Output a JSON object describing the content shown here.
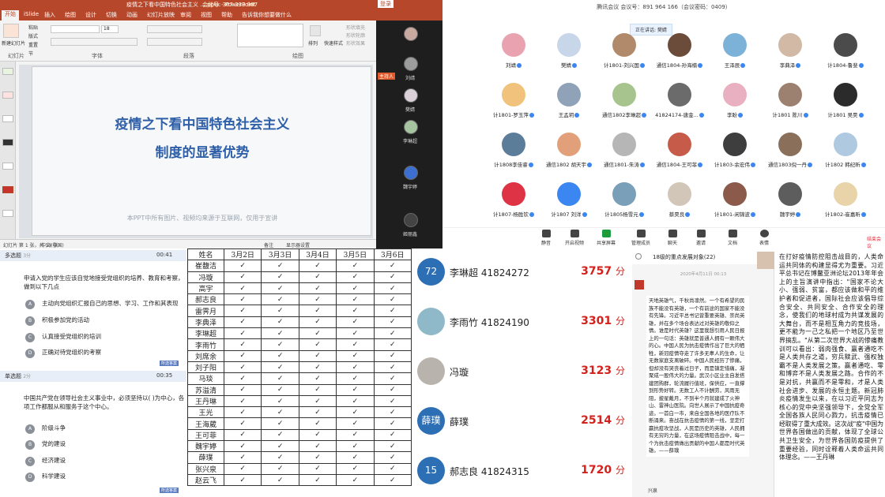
{
  "ppt": {
    "title": "疫情之下看中国特色社会主义 ... pptx - PowerPoint",
    "meeting_id": "会议号: 307 333 987",
    "login": "登录",
    "tabs": [
      "开始",
      "iSlide",
      "插入",
      "绘图",
      "设计",
      "切换",
      "动画",
      "幻灯片放映",
      "审阅",
      "视图",
      "帮助",
      "告诉我你想要做什么"
    ],
    "groups": [
      "幻灯片",
      "字体",
      "段落",
      "绘图"
    ],
    "buttons": {
      "new_slide": "新建幻灯片",
      "paste": "粘贴",
      "layout": "版式",
      "reset": "重置",
      "section": "节",
      "arrange": "排列",
      "quick_style": "快速样式",
      "shape_fill": "形状填充",
      "shape_outline": "形状轮廓",
      "shape_effect": "形状效果"
    },
    "font_size": "18",
    "slide_title_1": "疫情之下看中国特色社会主义",
    "slide_title_2": "制度的显著优势",
    "slide_note": "本PPT中所有图片、视频均来源于互联网，仅用于宣讲",
    "status_slide": "幻灯片 第 1 张，共 19 张",
    "status_lang": "中文(中国)",
    "status_notes": "备注",
    "status_display": "显示器设置",
    "video_names": [
      "",
      "刘靖",
      "樊婧",
      "李琳超",
      "魏宇婷",
      "姬丽鑫"
    ],
    "host_badge": "主持人"
  },
  "meeting": {
    "title": "腾讯会议  会议号：891 964 166（会议密码：0409）",
    "speaking": "正在讲话: 樊婧",
    "participants": [
      [
        "刘靖",
        "樊婧",
        "计1801-刘兴国",
        "通信1804-孙海楠",
        "王泽辰",
        "李典泽",
        "计1804-鲁斐"
      ],
      [
        "计1801-罗玉萍",
        "王孟玥",
        "通信1802李琳超",
        "41824174-唐金...",
        "李盼",
        "计1801 陈川",
        "计1801 吴昊"
      ],
      [
        "计1808李佳睿",
        "通信1802 胡天宇",
        "通信1801-朱涛",
        "通信1804-王可菲",
        "计1803-余宏伟",
        "通信1803倪一丹",
        "计1802 韩纪昕"
      ],
      [
        "计1807-杨胜钦",
        "计1807 刘洋",
        "计1805杨雪元",
        "蔡昊良",
        "计1801-闲锦波",
        "魏宇婷",
        "计1802-崔嘉昕"
      ]
    ],
    "toolbar": [
      "静音",
      "开启视频",
      "共享屏幕",
      "管理成员",
      "聊天",
      "邀请",
      "文档",
      "表情"
    ],
    "leave": "结束会议"
  },
  "quiz": {
    "q1_type": "多选题",
    "q1_score": "3分",
    "q1_timer": "00:41",
    "q1_text": "申请入党的学生应该自觉地接受党组织的培养、教育和考察，做到以下几点",
    "q1_options": [
      [
        "A",
        "主动向党组织汇报自己的思想、学习、工作和其表现"
      ],
      [
        "B",
        "积极参加党的活动"
      ],
      [
        "C",
        "认真接受党组织的培训"
      ],
      [
        "D",
        "正确对待党组织的考察"
      ]
    ],
    "q1_tag": "所选答案",
    "q2_type": "单选题",
    "q2_score": "2分",
    "q2_timer": "00:35",
    "q2_text": "中国共产党在领导社会主义事业中，必须坚持以(    )为中心，各项工作都服从和服务于这个中心。",
    "q2_options": [
      [
        "A",
        "阶级斗争"
      ],
      [
        "B",
        "党的建设"
      ],
      [
        "C",
        "经济建设"
      ],
      [
        "D",
        "科学建设"
      ]
    ],
    "q2_tag": "所选答案"
  },
  "attendance": {
    "headers": [
      "姓名",
      "3月2日",
      "3月3日",
      "3月4日",
      "3月5日",
      "3月6日"
    ],
    "names": [
      "崔馥洁",
      "冯璇",
      "高宇",
      "郝志良",
      "雷霁月",
      "李典泽",
      "李琳超",
      "李雨竹",
      "刘席余",
      "刘子阳",
      "马琰",
      "苏溢清",
      "王丹琳",
      "王光",
      "王海葳",
      "王可菲",
      "魏宇婷",
      "薛璞",
      "张兴泉",
      "赵云飞"
    ],
    "mark": "✓"
  },
  "leaderboard": [
    {
      "avatar_text": "72",
      "name": "李琳超 41824272",
      "score": "3757",
      "unit": "分",
      "color": "#2d6fb5"
    },
    {
      "avatar_text": "",
      "name": "李雨竹 41824190",
      "score": "3301",
      "unit": "分",
      "color": "#8fb8c8"
    },
    {
      "avatar_text": "",
      "name": "冯璇",
      "score": "3123",
      "unit": "分",
      "color": "#b9b3ae"
    },
    {
      "avatar_text": "薛璞",
      "name": "薛璞",
      "score": "2514",
      "unit": "分",
      "color": "#2d6fb5"
    },
    {
      "avatar_text": "15",
      "name": "郝志良 41824315",
      "score": "1720",
      "unit": "分",
      "color": "#2d6fb5"
    }
  ],
  "chat": {
    "header": "18级的重点发展对象(22)",
    "date": "2020年4月11日 00:13",
    "message": "天地英雄气，千秋尚凛然。一个有希望的民族不能没有英雄，一个有前途的国家不能没有先锋。习近平总书记曾重要英雄、崇尚英雄，并在多个场合表达过对英雄的敬仰之情。谁是时代英雄？这里我想引用人民日报上的一句话：英雄就是普通人拥有一颗伟大的心。中国人民为抗击疫情作出了巨大的牺牲，新冠疫情夺走了许多无辜人的生命，让无数家庭支离破碎。中国人民经历了惨痛，但却没有哭丧着过日子，而是镇定惜痛，凝聚成一股伟大的力量。武汉小区业主自发搭建团购群，轮流履行值班，保供应，一直撑到形势好转。无数工人不计酬劳，风雨无阻，披星戴月，不到半个月就建成了火神山、雷神山医院。向世人展示了中国抗疫奇迹。一首白一市，来自全国各地的医疗队不断涌来。奋战在抗击疫情的第一线，坚定打赢抗疫攻坚战，人民是历史的英雄，人民拥有无穷的力量，在这场疫情阻击战中，每一个为抗击疫情做出贡献的中国人都是时代英雄。——薛璞",
    "sender": "兴泉"
  },
  "document": {
    "text": "在打好疫情防控阻击战目的，人类命运共同体的构建显得尤为重要。习近平总书记在博鳌亚洲论坛2013年年会上的主旨演讲中指出：\"国家不论大小、强弱、贫富，都应该做和平的维护者和促进者，国际社会应该倡导综合安全、共同安全、合作安全的理念，使我们的地球村成为共谋发展的大舞台，而不是相互角力的竞技场，更不能为一己之私把一个地区乃至世界搞乱。\"从第二次世界大战的惨痛教训可以看出：弱肉强食、赢者通吃不是人类共存之道，穷兵黩武、强权独霸不是人类发展之策。赢者通吃、零和博弈不是人类发展之路。合作的不是对抗，共赢而不是零和，才是人类社会进步、发展的永恒主题。新冠肺炎疫情发生以来，在以习近平同志为核心的党中央坚强领导下，全党全军全国各族人民同心戮力，抗击疫情已经取得了重大成效。这次战\"疫\"中国为世界各国做出的贡献，体现了全球公共卫生安全，为世界各国防疫提供了重要经验，同时诠释着人类命运共同体理念。——王丹琳"
  },
  "colors": {
    "ppt_red": "#b7472a",
    "slide_blue": "#2e5fa8",
    "score_red": "#d3221d",
    "brand_blue": "#2d6fb5"
  }
}
